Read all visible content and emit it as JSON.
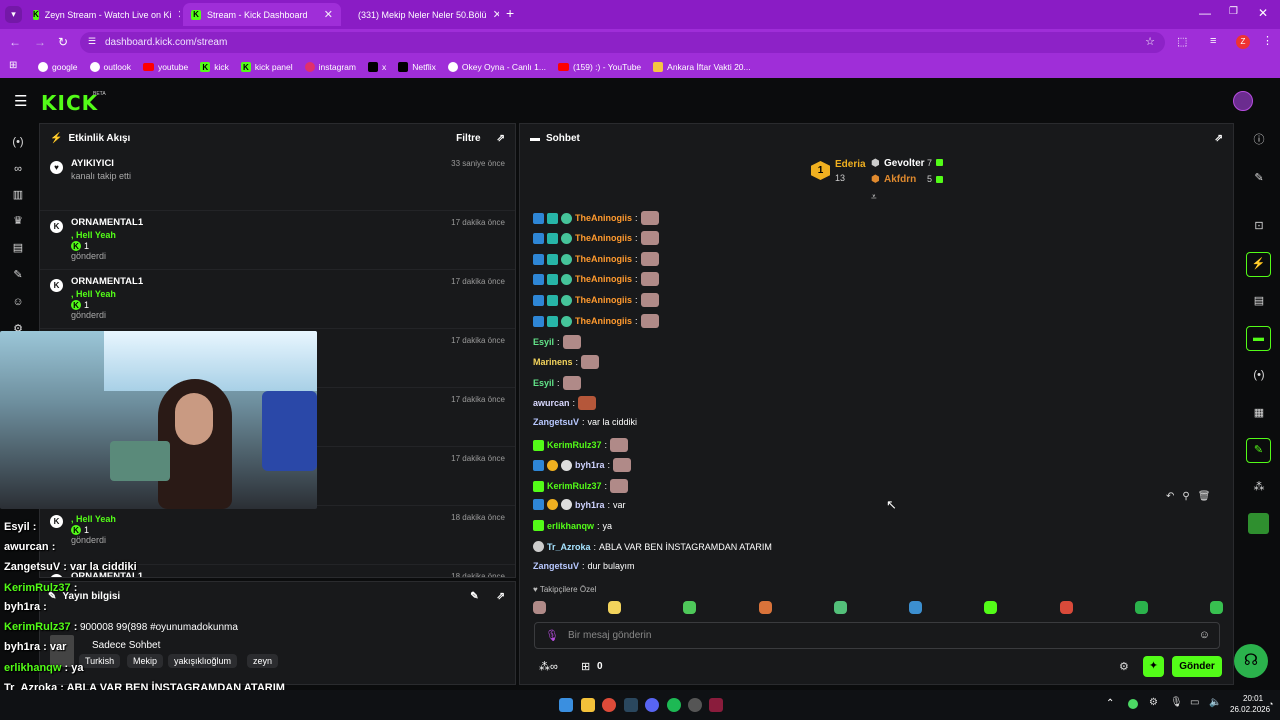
{
  "browser": {
    "tabs": [
      {
        "title": "Zeyn Stream - Watch Live on Ki",
        "favicon": "kick-icon"
      },
      {
        "title": "Stream - Kick Dashboard",
        "favicon": "kick-icon"
      },
      {
        "title": "(331) Mekip Neler Neler 50.Bölü",
        "favicon": "youtube-icon"
      }
    ],
    "url": "dashboard.kick.com/stream",
    "profile_letter": "Z",
    "bookmarks": [
      "google",
      "outlook",
      "youtube",
      "kick",
      "kick panel",
      "instagram",
      "x",
      "Netflix",
      "Okey Oyna - Canlı 1...",
      "(159) :) - YouTube",
      "Ankara İftar Vakti 20..."
    ]
  },
  "header": {
    "logo": "KICK",
    "beta": "BETA"
  },
  "activity": {
    "title": "Etkinlik Akışı",
    "filter_label": "Filtre",
    "events": [
      {
        "name": "AYIKIYICI",
        "line1": "kanalı takip etti",
        "line2": "",
        "amount": "",
        "line3": "",
        "time": "33 saniye önce"
      },
      {
        "name": "ORNAMENTAL1",
        "line1": ", Hell Yeah",
        "line2": "",
        "amount": "1",
        "line3": "gönderdi",
        "time": "17 dakika önce"
      },
      {
        "name": "ORNAMENTAL1",
        "line1": ", Hell Yeah",
        "line2": "",
        "amount": "1",
        "line3": "gönderdi",
        "time": "17 dakika önce"
      },
      {
        "name": "ORNAMENTAL1",
        "line1": "",
        "line2": "",
        "amount": "",
        "line3": "",
        "time": "17 dakika önce"
      },
      {
        "name": "",
        "line1": "",
        "line2": "",
        "amount": "",
        "line3": "",
        "time": "17 dakika önce"
      },
      {
        "name": "",
        "line1": "",
        "line2": "",
        "amount": "",
        "line3": "",
        "time": "17 dakika önce"
      },
      {
        "name": "",
        "line1": ", Hell Yeah",
        "line2": "",
        "amount": "1",
        "line3": "gönderdi",
        "time": "18 dakika önce"
      },
      {
        "name": "ORNAMENTAL1",
        "line1": "",
        "line2": "",
        "amount": "",
        "line3": "",
        "time": "18 dakika önce"
      }
    ]
  },
  "stream_info": {
    "title": "Yayın bilgisi",
    "stream_title": "900008 99(898 #oyunumadokunma",
    "category": "Sadece Sohbet",
    "tags": [
      "Turkish",
      "Mekip",
      "yakışıklıoğlum",
      "zeyn"
    ]
  },
  "chat": {
    "title": "Sohbet",
    "leaderboard": [
      {
        "rank": "1",
        "name": "Ederia",
        "count": "13"
      },
      {
        "name": "Gevolter",
        "count": "7"
      },
      {
        "name": "Akfdrn",
        "count": "5"
      }
    ],
    "messages": [
      {
        "user": "TheAninogiis",
        "color": "#ff9a2e",
        "text": ""
      },
      {
        "user": "TheAninogiis",
        "color": "#ff9a2e",
        "text": ""
      },
      {
        "user": "TheAninogiis",
        "color": "#ff9a2e",
        "text": ""
      },
      {
        "user": "TheAninogiis",
        "color": "#ff9a2e",
        "text": ""
      },
      {
        "user": "TheAninogiis",
        "color": "#ff9a2e",
        "text": ""
      },
      {
        "user": "TheAninogiis",
        "color": "#ff9a2e",
        "text": ""
      },
      {
        "user": "Esyil",
        "color": "#63e58a",
        "text": ""
      },
      {
        "user": "Marinens",
        "color": "#f2d35c",
        "text": ""
      },
      {
        "user": "Esyil",
        "color": "#63e58a",
        "text": ""
      },
      {
        "user": "awurcan",
        "color": "#d9d9ff",
        "text": ""
      },
      {
        "user": "ZangetsuV",
        "color": "#b8c8ff",
        "text": "var la ciddiki"
      },
      {
        "user": "KerimRulz37",
        "color": "#53fc18",
        "text": ""
      },
      {
        "user": "byh1ra",
        "color": "#cfd3ff",
        "text": ""
      },
      {
        "user": "KerimRulz37",
        "color": "#53fc18",
        "text": ""
      },
      {
        "user": "byh1ra",
        "color": "#cfd3ff",
        "text": "var"
      },
      {
        "user": "erlikhanqw",
        "color": "#53fc18",
        "text": "ya"
      },
      {
        "user": "Tr_Azroka",
        "color": "#a6e3ff",
        "text": "ABLA VAR BEN İNSTAGRAMDAN ATARIM"
      },
      {
        "user": "ZangetsuV",
        "color": "#b8c8ff",
        "text": "dur bulayım"
      }
    ],
    "emote_tab": "Takipçilere Özel",
    "input_placeholder": "Bir mesaj gönderin",
    "points": "0",
    "send_label": "Gönder"
  },
  "overlay_chat": [
    {
      "user": "Esyil",
      "text": ""
    },
    {
      "user": "awurcan",
      "text": ""
    },
    {
      "user": "ZangetsuV",
      "text": "var la ciddiki"
    },
    {
      "user": "KerimRulz37",
      "text": ""
    },
    {
      "user": "byh1ra",
      "text": ""
    },
    {
      "user": "KerimRulz37",
      "text": ""
    },
    {
      "user": "byh1ra",
      "text": "var"
    },
    {
      "user": "erlikhanqw",
      "text": "ya"
    },
    {
      "user": "Tr_Azroka",
      "text": "ABLA VAR BEN İNSTAGRAMDAN ATARIM"
    },
    {
      "user": "ZangetsuV",
      "text": "dur bulayım"
    }
  ],
  "taskbar": {
    "time": "20:01",
    "date": "26.02.2026"
  },
  "colors": {
    "kick_green": "#53fc18",
    "browser_purple": "#9f2ed8",
    "panel_bg": "#18191b"
  }
}
